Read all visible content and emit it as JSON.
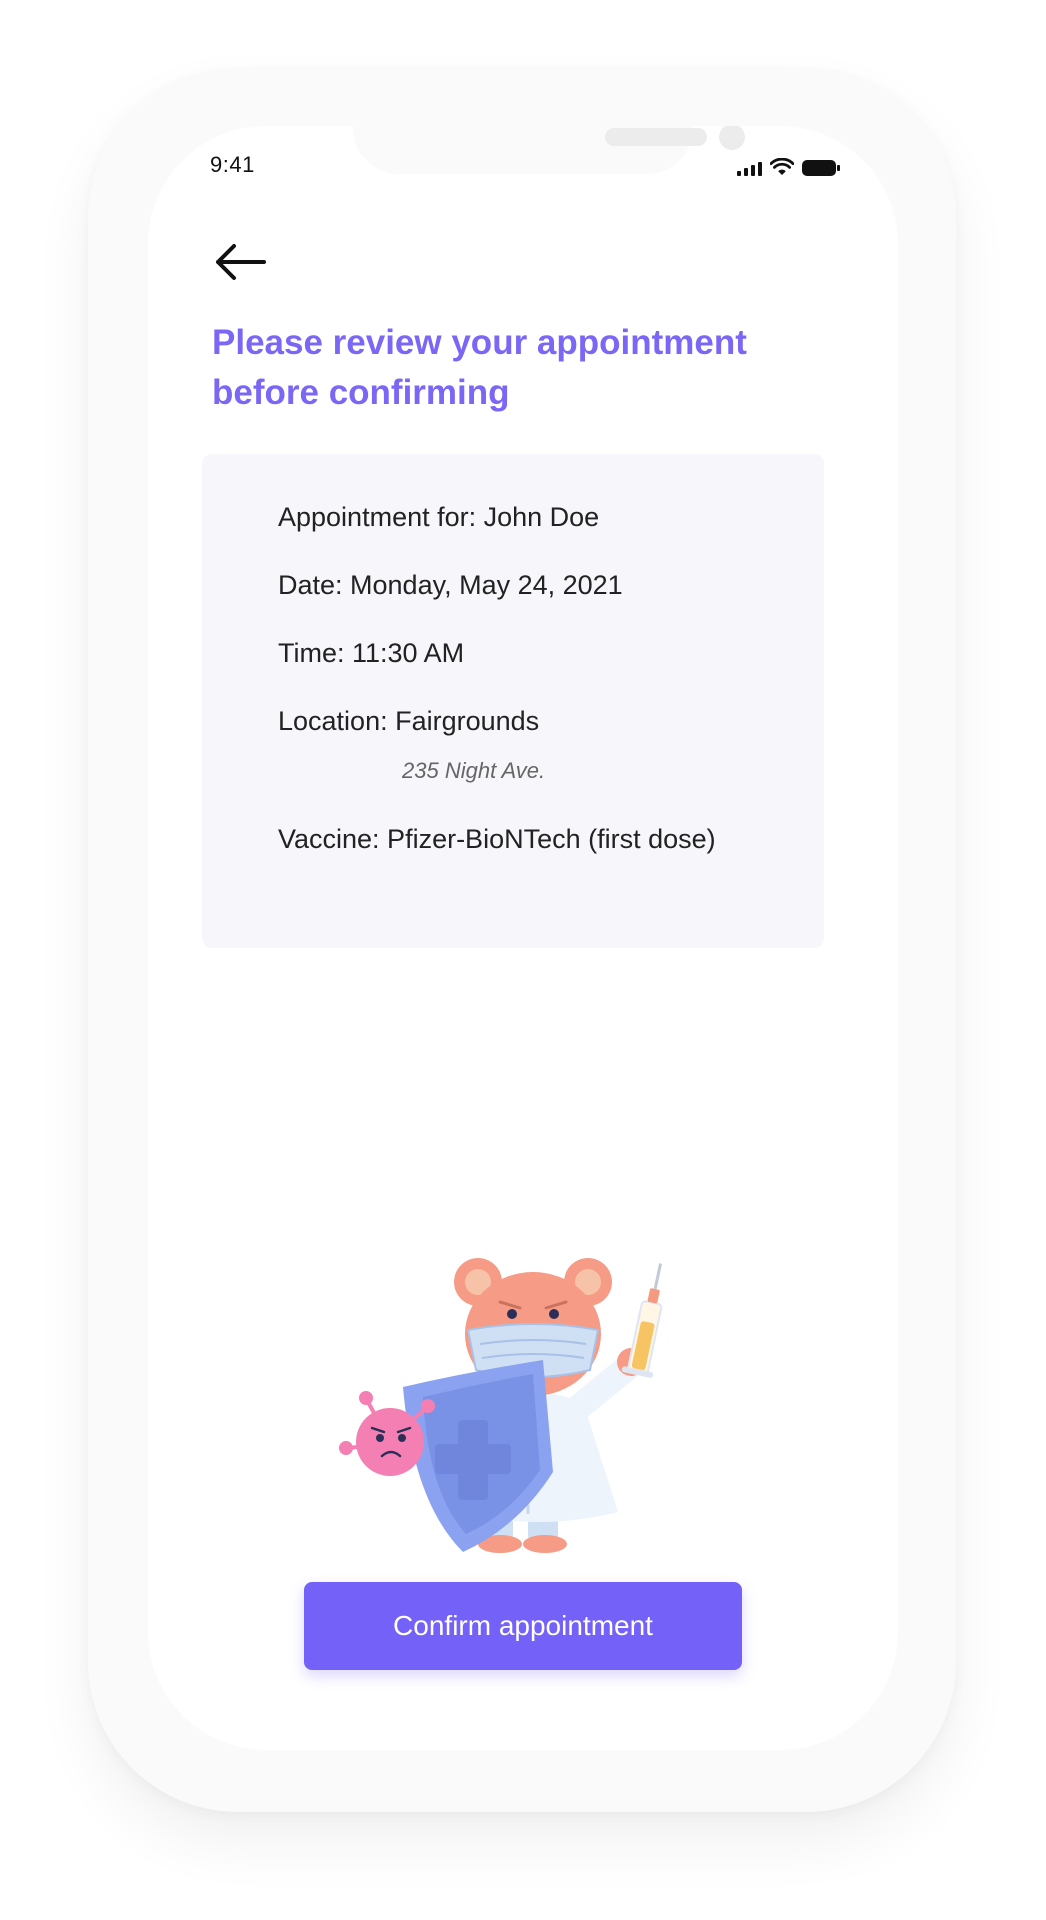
{
  "status_bar": {
    "time": "9:41"
  },
  "header": {
    "back_icon": "arrow-left-icon",
    "title": "Please review your appointment before confirming"
  },
  "appointment": {
    "for": "Appointment for: John Doe",
    "date": "Date: Monday, May 24, 2021",
    "time": "Time: 11:30 AM",
    "location": "Location: Fairgrounds",
    "address": "235 Night Ave.",
    "vaccine": "Vaccine: Pfizer-BioNTech (first dose)"
  },
  "illustration": {
    "icon": "bear-doctor-vaccine-illustration"
  },
  "actions": {
    "confirm_label": "Confirm appointment"
  },
  "colors": {
    "accent": "#7461f8",
    "heading": "#7b67f5",
    "card_background": "#f6f6fb"
  }
}
